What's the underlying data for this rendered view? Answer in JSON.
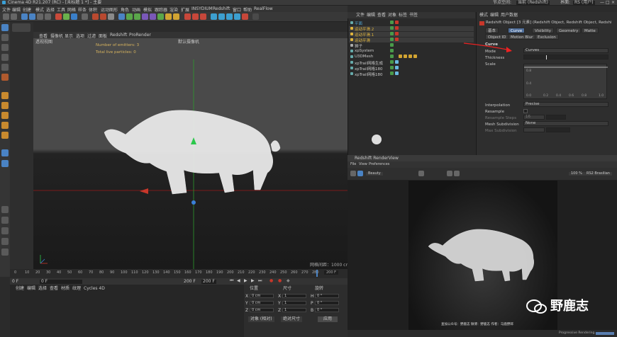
{
  "window": {
    "title": "Cinema 4D R21.207 (RC) - [未标题 1 *] - 主要",
    "node_space_label": "节点空间:",
    "node_space_value": "当前 (Redshift)",
    "interface_label": "界面:",
    "interface_value": "RS (用户)"
  },
  "menu": [
    "文件",
    "编辑",
    "创建",
    "模式",
    "选择",
    "工具",
    "网格",
    "样条",
    "体积",
    "运动图形",
    "角色",
    "动画",
    "模拟",
    "跟踪器",
    "渲染",
    "扩展",
    "INSYDIUM",
    "Redshift",
    "窗口",
    "帮助",
    "RealFlow"
  ],
  "viewport": {
    "menu": [
      "查看",
      "摄像机",
      "显示",
      "选项",
      "过滤",
      "面板",
      "Redshift",
      "ProRender"
    ],
    "view_name": "透视视图",
    "camera_label": "默认摄像机",
    "hud_emitters": "Number of emitters: 3",
    "hud_particles": "Total live particles: 0",
    "grid_spacing": "网格间距：1000 cm"
  },
  "timeline": {
    "ticks": [
      "0",
      "10",
      "20",
      "30",
      "40",
      "50",
      "60",
      "70",
      "80",
      "90",
      "100",
      "110",
      "120",
      "130",
      "140",
      "150",
      "160",
      "170",
      "180",
      "190",
      "200",
      "210",
      "220",
      "230",
      "240",
      "250",
      "260",
      "270",
      "280"
    ],
    "start": "0 F",
    "start2": "0 F",
    "end": "200 F",
    "end2": "200 F",
    "current": "200 F"
  },
  "material_menu": [
    "创建",
    "编辑",
    "选择",
    "查看",
    "材质",
    "纹理",
    "Cycles 4D"
  ],
  "coords": {
    "headers": [
      "位置",
      "尺寸",
      "旋转"
    ],
    "rows": [
      {
        "axis": "X",
        "pos": "0 cm",
        "size": "1",
        "rot_axis": "H",
        "rot": "0 °"
      },
      {
        "axis": "Y",
        "pos": "0 cm",
        "size": "1",
        "rot_axis": "P",
        "rot": "0 °"
      },
      {
        "axis": "Z",
        "pos": "0 cm",
        "size": "1",
        "rot_axis": "B",
        "rot": "0 °"
      }
    ],
    "mode1": "对象 (相对)",
    "mode2": "绝对尺寸",
    "apply": "应用"
  },
  "objects": {
    "menu": [
      "文件",
      "编辑",
      "查看",
      "对象",
      "标签",
      "书签"
    ],
    "items": [
      {
        "name": "平面",
        "color": "#4fa3d1"
      },
      {
        "name": "运动平滑.2",
        "color": "#e0b43c"
      },
      {
        "name": "运动平滑.1",
        "color": "#e0b43c"
      },
      {
        "name": "运动平滑",
        "color": "#e0b43c"
      },
      {
        "name": "狮子",
        "color": "#cccccc"
      },
      {
        "name": "xpSystem",
        "color": "#9fc4e8"
      },
      {
        "name": "U3DMesh",
        "color": "#9fc4e8"
      },
      {
        "name": "xpTrail网格生成",
        "color": "#9fc4e8"
      },
      {
        "name": "xpTrail网格180",
        "color": "#9fc4e8"
      },
      {
        "name": "xpTrail网格180",
        "color": "#9fc4e8"
      }
    ]
  },
  "attributes": {
    "menu": [
      "模式",
      "编辑",
      "用户数据"
    ],
    "object_title": "Redshift Object [3 元素] (Redshift Object, Redshift Object, Redshi",
    "tabs_row1": [
      "基本",
      "Curve",
      "Visibility",
      "Geometry",
      "Matte"
    ],
    "tabs_row2": [
      "Object ID",
      "Motion Blur",
      "Exclusion"
    ],
    "section": "Curve",
    "mode_label": "Mode",
    "mode_value": "Curves",
    "thickness_label": "Thickness",
    "scale_label": "Scale",
    "graph_y": [
      "0.8",
      "0.4"
    ],
    "graph_x": [
      "0.2",
      "0.4",
      "0.6",
      "0.8",
      "1.0"
    ],
    "graph_x0": "0.0",
    "interpolation_label": "Interpolation",
    "interpolation_value": "Precise",
    "resample_label": "Resample",
    "resample_steps_label": "Resample Steps",
    "resample_steps_value": "16",
    "mesh_subdiv_label": "Mesh Subdivision",
    "mesh_subdiv_value": "None",
    "max_subdiv_label": "Max Subdivision"
  },
  "renderview": {
    "title": "Redshift RenderView",
    "menu": [
      "File",
      "View",
      "Preferences"
    ],
    "beauty": "Beauty",
    "zoom": "100 %",
    "region_label": "RS2 Brasilian",
    "caption": "查加公众号：野鹿志  微博：野鹿志  作者：马鹿野郎",
    "status": "Progressive Rendering..."
  },
  "watermark": "野鹿志"
}
